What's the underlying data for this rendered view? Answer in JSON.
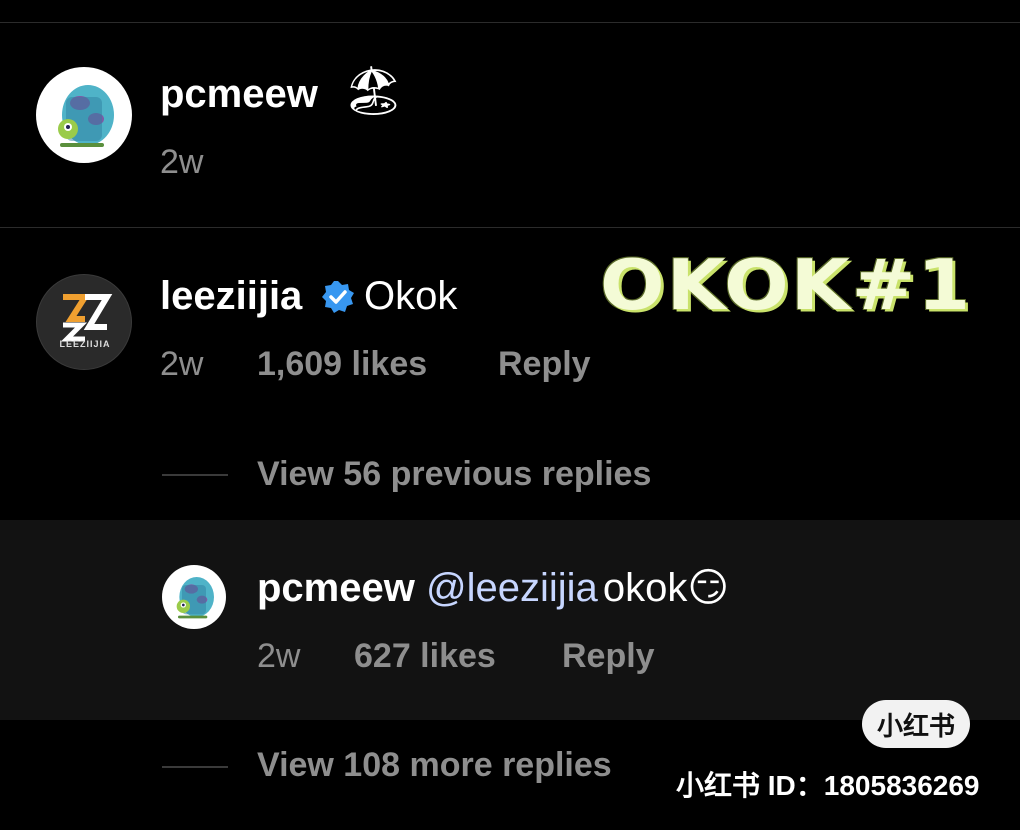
{
  "comments": [
    {
      "username": "pcmeew",
      "text_emoji": "🏖",
      "time": "2w"
    },
    {
      "username": "leeziijia",
      "verified": true,
      "text": "Okok",
      "time": "2w",
      "likes": "1,609 likes",
      "reply_label": "Reply",
      "avatar_text": "LEEZIIJIA",
      "view_replies": "View 56 previous replies"
    }
  ],
  "reply": {
    "username": "pcmeew",
    "mention": "@leeziijia",
    "text": "okok",
    "emoji": "😏",
    "time": "2w",
    "likes": "627 likes",
    "reply_label": "Reply",
    "view_replies": "View 108 more replies"
  },
  "overlay": {
    "title": "OKOK#1",
    "badge": "小红书",
    "watermark": "小红书 ID：1805836269"
  },
  "colors": {
    "background": "#000000",
    "muted_text": "#8e8e8e",
    "verified_blue": "#3897f0",
    "mention": "#c7d6ff",
    "overlay_text": "#f4fbd6"
  }
}
